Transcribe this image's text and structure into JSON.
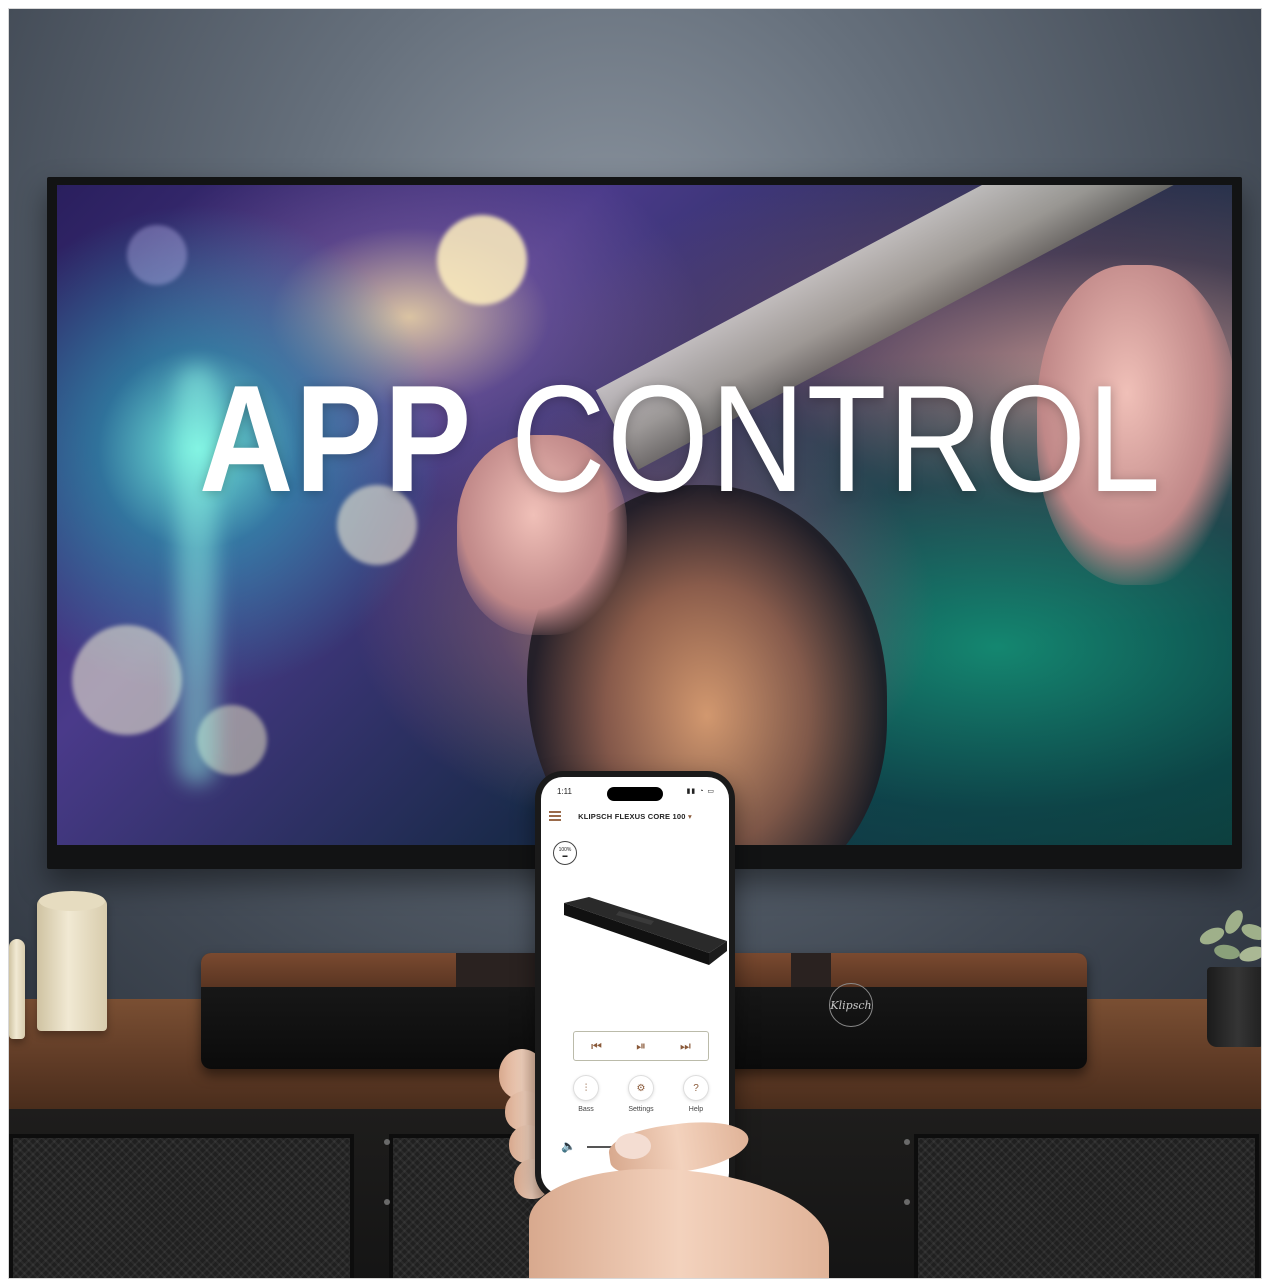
{
  "tv_screen": {
    "headline_bold": "APP",
    "headline_light": "CONTROL"
  },
  "phone": {
    "status_time": "1:11",
    "status_icons": "▮▮ ◔ ▭",
    "device_name": "KLIPSCH FLEXUS CORE 100",
    "device_dropdown_icon": "caret-down",
    "battery_percent": "100%",
    "transport": {
      "previous_icon": "skip-previous",
      "play_pause_icon": "play-pause",
      "next_icon": "skip-next"
    },
    "quick_actions": [
      {
        "label": "Bass",
        "icon": "equalizer-icon"
      },
      {
        "label": "Settings",
        "icon": "gear-icon"
      },
      {
        "label": "Help",
        "icon": "help-icon"
      }
    ],
    "volume_level": 0.3
  },
  "soundbar": {
    "brand_badge": "Klipsch"
  },
  "colors": {
    "accent": "#8a5a3a",
    "wall": "#5a636e",
    "cabinet": "#6a432c"
  }
}
